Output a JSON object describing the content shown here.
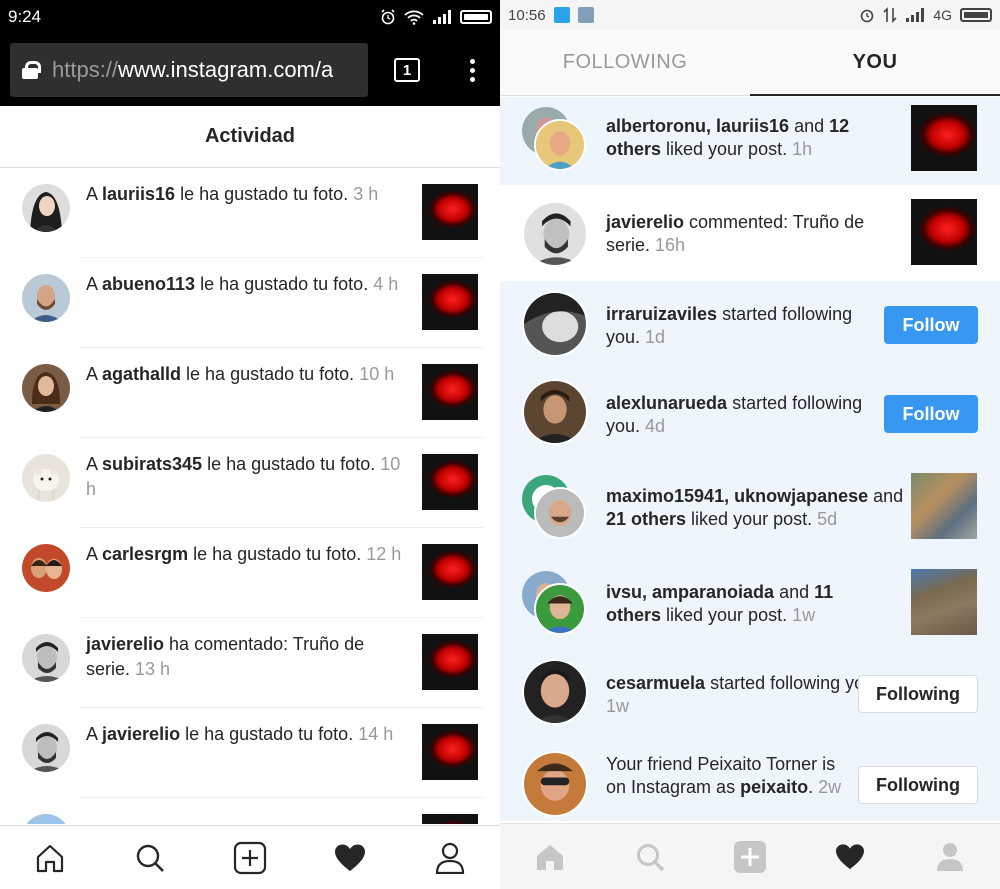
{
  "left": {
    "status": {
      "time": "9:24"
    },
    "url": {
      "proto": "https://",
      "rest": "www.instagram.com/a"
    },
    "tab_count": "1",
    "header_title": "Actividad",
    "items": [
      {
        "pre": "A ",
        "user": "lauriis16",
        "post": " le ha gustado tu foto.",
        "time": "3 h"
      },
      {
        "pre": "A ",
        "user": "abueno113",
        "post": " le ha gustado tu foto.",
        "time": "4 h"
      },
      {
        "pre": "A ",
        "user": "agathalld",
        "post": " le ha gustado tu foto.",
        "time": "10 h"
      },
      {
        "pre": "A ",
        "user": "subirats345",
        "post": " le ha gustado tu foto.",
        "time": "10 h"
      },
      {
        "pre": "A ",
        "user": "carlesrgm",
        "post": " le ha gustado tu foto.",
        "time": "12 h"
      },
      {
        "pre": "",
        "user": "javierelio",
        "post": " ha comentado: Truño de serie.",
        "time": "13 h"
      },
      {
        "pre": "A ",
        "user": "javierelio",
        "post": " le ha gustado tu foto.",
        "time": "14 h"
      }
    ],
    "nav": [
      "home-icon",
      "search-icon",
      "add-icon",
      "heart-icon",
      "profile-icon"
    ]
  },
  "right": {
    "status": {
      "time": "10:56",
      "network": "4G"
    },
    "tabs": {
      "following": "FOLLOWING",
      "you": "YOU"
    },
    "items": [
      {
        "users": "albertoronu, lauriis16",
        "mid": " and ",
        "count": "12 others",
        "post": " liked your post.",
        "time": "1h"
      },
      {
        "user": "javierelio",
        "post": " commented: Truño de serie.",
        "time": "16h"
      },
      {
        "user": "irraruizaviles",
        "post": " started following you.",
        "time": "1d",
        "button": "Follow"
      },
      {
        "user": "alexlunarueda",
        "post": " started following you.",
        "time": "4d",
        "button": "Follow"
      },
      {
        "users": "maximo15941, uknowjapanese",
        "mid": " and ",
        "count": "21 others",
        "post": " liked your post.",
        "time": "5d"
      },
      {
        "users": "ivsu, amparanoiada",
        "mid": " and ",
        "count": "11 others",
        "post": " liked your post.",
        "time": "1w"
      },
      {
        "user": "cesarmuela",
        "post": " started following you.",
        "time": "1w",
        "button": "Following"
      },
      {
        "pre": "Your friend Peixaito Torner is on Instagram as ",
        "user": "peixaito",
        "post": ".",
        "time": "2w",
        "button": "Following"
      }
    ]
  }
}
